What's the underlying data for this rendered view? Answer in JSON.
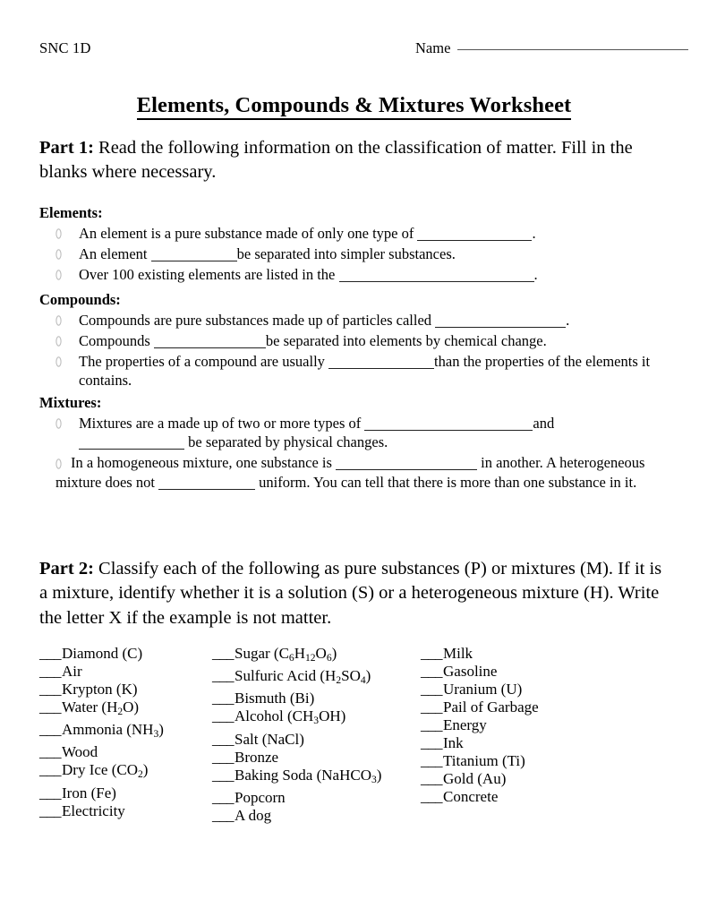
{
  "header": {
    "course_code": "SNC 1D",
    "name_label": "Name"
  },
  "title": "Elements, Compounds & Mixtures Worksheet",
  "part1": {
    "label": "Part 1:",
    "instructions": " Read the following information on the classification of matter.  Fill in the blanks where necessary.",
    "sections": [
      {
        "heading": "Elements:",
        "bullets": [
          {
            "pre": "An element is a pure substance made of only one type of ",
            "blank_width": 128,
            "post": "."
          },
          {
            "pre": "An element ",
            "blank_width": 96,
            "post": "be separated into simpler substances."
          },
          {
            "pre": "Over 100 existing elements are listed in the ",
            "blank_width": 218,
            "post": "."
          }
        ]
      },
      {
        "heading": "Compounds:",
        "bullets": [
          {
            "pre": "Compounds are pure substances made up of particles called ",
            "blank_width": 146,
            "post": "."
          },
          {
            "pre": "Compounds ",
            "blank_width": 125,
            "post": "be separated into elements by chemical change."
          },
          {
            "pre": "The properties of a compound are usually ",
            "blank_width": 118,
            "post": "than the properties of the elements it contains."
          }
        ]
      },
      {
        "heading": "Mixtures:",
        "bullets": [
          {
            "pre": "Mixtures are a made up of two or more types of ",
            "blank_width": 188,
            "post": "and"
          },
          {
            "pre": "In a homogeneous mixture, one substance is ",
            "blank_width": 158,
            "post": " in another. A heterogeneous mixture does not "
          }
        ],
        "mixture_line2_blank_width": 118,
        "mixture_line2_post": " be separated by physical changes.",
        "mixture_b2_blank2_width": 108,
        "mixture_b2_tail": " uniform. You can tell that there is more than one substance in it."
      }
    ]
  },
  "part2": {
    "label": "Part 2:",
    "instructions": " Classify each of the following as pure substances (P) or mixtures (M).  If it is a mixture, identify whether it is a solution (S) or a heterogeneous mixture (H).  Write the letter X if the example is not matter.",
    "blank_lead": "___",
    "columns": [
      {
        "items": [
          {
            "name": "Diamond (C)"
          },
          {
            "name": "Air"
          },
          {
            "name": "Krypton (K)"
          },
          {
            "name": "Water (H",
            "sub1": "2",
            "mid": "O)"
          },
          {
            "name": "Ammonia (NH",
            "sub1": "3",
            "mid": ")"
          },
          {
            "name": "Wood"
          },
          {
            "name": "Dry Ice (CO",
            "sub1": "2",
            "mid": ")"
          },
          {
            "name": "Iron (Fe)"
          },
          {
            "name": "Electricity"
          }
        ]
      },
      {
        "items": [
          {
            "name": "Sugar (C",
            "sub1": "6",
            "mid": "H",
            "sub2": "12",
            "mid2": "O",
            "sub3": "6",
            "mid3": ")"
          },
          {
            "name": "Sulfuric Acid (H",
            "sub1": "2",
            "mid": "SO",
            "sub2": "4",
            "mid2": ")"
          },
          {
            "name": "Bismuth (Bi)"
          },
          {
            "name": "Alcohol (CH",
            "sub1": "3",
            "mid": "OH)"
          },
          {
            "name": "Salt (NaCl)"
          },
          {
            "name": "Bronze"
          },
          {
            "name": "Baking Soda (NaHCO",
            "sub1": "3",
            "mid": ")"
          },
          {
            "name": "Popcorn"
          },
          {
            "name": "A dog"
          }
        ]
      },
      {
        "items": [
          {
            "name": "Milk"
          },
          {
            "name": "Gasoline"
          },
          {
            "name": "Uranium (U)"
          },
          {
            "name": "Pail of Garbage"
          },
          {
            "name": "Energy"
          },
          {
            "name": "Ink"
          },
          {
            "name": "Titanium (Ti)"
          },
          {
            "name": "Gold (Au)"
          },
          {
            "name": "Concrete"
          }
        ]
      }
    ]
  },
  "icons": {
    "bullet": "hollow-oval-bullet-icon"
  }
}
